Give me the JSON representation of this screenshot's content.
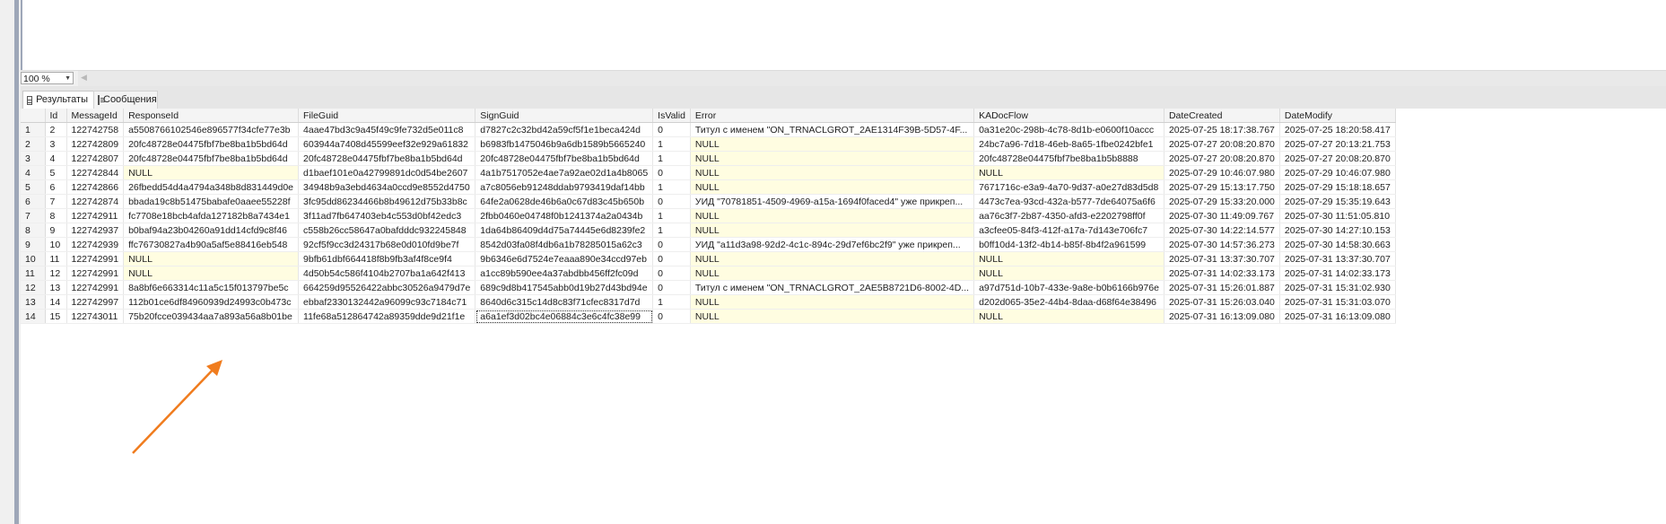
{
  "zoom": {
    "value": "100 %"
  },
  "tabs": [
    {
      "label": "Результаты",
      "icon": "grid-icon"
    },
    {
      "label": "Сообщения",
      "icon": "messages-icon"
    }
  ],
  "table": {
    "columns": [
      "",
      "Id",
      "MessageId",
      "ResponseId",
      "FileGuid",
      "SignGuid",
      "IsValid",
      "Error",
      "KADocFlow",
      "DateCreated",
      "DateModify"
    ],
    "rows": [
      [
        "1",
        "2",
        "122742758",
        "a5508766102546e896577f34cfe77e3b",
        "4aae47bd3c9a45f49c9fe732d5e011c8",
        "d7827c2c32bd42a59cf5f1e1beca424d",
        "0",
        "Титул с именем \"ON_TRNACLGROT_2AE1314F39B-5D57-4F...",
        "0a31e20c-298b-4c78-8d1b-e0600f10accc",
        "2025-07-25 18:17:38.767",
        "2025-07-25 18:20:58.417"
      ],
      [
        "2",
        "3",
        "122742809",
        "20fc48728e04475fbf7be8ba1b5bd64d",
        "603944a7408d45599eef32e929a61832",
        "b6983fb1475046b9a6db1589b5665240",
        "1",
        "NULL",
        "24bc7a96-7d18-46eb-8a65-1fbe0242bfe1",
        "2025-07-27 20:08:20.870",
        "2025-07-27 20:13:21.753"
      ],
      [
        "3",
        "4",
        "122742807",
        "20fc48728e04475fbf7be8ba1b5bd64d",
        "20fc48728e04475fbf7be8ba1b5bd64d",
        "20fc48728e04475fbf7be8ba1b5bd64d",
        "1",
        "NULL",
        "20fc48728e04475fbf7be8ba1b5b8888",
        "2025-07-27 20:08:20.870",
        "2025-07-27 20:08:20.870"
      ],
      [
        "4",
        "5",
        "122742844",
        "NULL",
        "d1baef101e0a42799891dc0d54be2607",
        "4a1b7517052e4ae7a92ae02d1a4b8065",
        "0",
        "NULL",
        "NULL",
        "2025-07-29 10:46:07.980",
        "2025-07-29 10:46:07.980"
      ],
      [
        "5",
        "6",
        "122742866",
        "26fbedd54d4a4794a348b8d831449d0e",
        "34948b9a3ebd4634a0ccd9e8552d4750",
        "a7c8056eb91248ddab9793419daf14bb",
        "1",
        "NULL",
        "7671716c-e3a9-4a70-9d37-a0e27d83d5d8",
        "2025-07-29 15:13:17.750",
        "2025-07-29 15:18:18.657"
      ],
      [
        "6",
        "7",
        "122742874",
        "bbada19c8b51475babafe0aaee55228f",
        "3fc95dd86234466b8b49612d75b33b8c",
        "64fe2a0628de46b6a0c67d83c45b650b",
        "0",
        "УИД \"70781851-4509-4969-a15a-1694f0faced4\" уже прикреп...",
        "4473c7ea-93cd-432a-b577-7de64075a6f6",
        "2025-07-29 15:33:20.000",
        "2025-07-29 15:35:19.643"
      ],
      [
        "7",
        "8",
        "122742911",
        "fc7708e18bcb4afda127182b8a7434e1",
        "3f11ad7fb647403eb4c553d0bf42edc3",
        "2fbb0460e04748f0b1241374a2a0434b",
        "1",
        "NULL",
        "aa76c3f7-2b87-4350-afd3-e2202798ff0f",
        "2025-07-30 11:49:09.767",
        "2025-07-30 11:51:05.810"
      ],
      [
        "8",
        "9",
        "122742937",
        "b0baf94a23b04260a91dd14cfd9c8f46",
        "c558b26cc58647a0bafdddc932245848",
        "1da64b86409d4d75a74445e6d8239fe2",
        "1",
        "NULL",
        "a3cfee05-84f3-412f-a17a-7d143e706fc7",
        "2025-07-30 14:22:14.577",
        "2025-07-30 14:27:10.153"
      ],
      [
        "9",
        "10",
        "122742939",
        "ffc76730827a4b90a5af5e88416eb548",
        "92cf5f9cc3d24317b68e0d010fd9be7f",
        "8542d03fa08f4db6a1b78285015a62c3",
        "0",
        "УИД \"a11d3a98-92d2-4c1c-894c-29d7ef6bc2f9\" уже прикреп...",
        "b0ff10d4-13f2-4b14-b85f-8b4f2a961599",
        "2025-07-30 14:57:36.273",
        "2025-07-30 14:58:30.663"
      ],
      [
        "10",
        "11",
        "122742991",
        "NULL",
        "9bfb61dbf664418f8b9fb3af4f8ce9f4",
        "9b6346e6d7524e7eaaa890e34ccd97eb",
        "0",
        "NULL",
        "NULL",
        "2025-07-31 13:37:30.707",
        "2025-07-31 13:37:30.707"
      ],
      [
        "11",
        "12",
        "122742991",
        "NULL",
        "4d50b54c586f4104b2707ba1a642f413",
        "a1cc89b590ee4a37abdbb456ff2fc09d",
        "0",
        "NULL",
        "NULL",
        "2025-07-31 14:02:33.173",
        "2025-07-31 14:02:33.173"
      ],
      [
        "12",
        "13",
        "122742991",
        "8a8bf6e663314c11a5c15f013797be5c",
        "664259d95526422abbc30526a9479d7e",
        "689c9d8b417545abb0d19b27d43bd94e",
        "0",
        "Титул с именем \"ON_TRNACLGROT_2AE5B8721D6-8002-4D...",
        "a97d751d-10b7-433e-9a8e-b0b6166b976e",
        "2025-07-31 15:26:01.887",
        "2025-07-31 15:31:02.930"
      ],
      [
        "13",
        "14",
        "122742997",
        "112b01ce6df84960939d24993c0b473c",
        "ebbaf2330132442a96099c93c7184c71",
        "8640d6c315c14d8c83f71cfec8317d7d",
        "1",
        "NULL",
        "d202d065-35e2-44b4-8daa-d68f64e38496",
        "2025-07-31 15:26:03.040",
        "2025-07-31 15:31:03.070"
      ],
      [
        "14",
        "15",
        "122743011",
        "75b20fcce039434aa7a893a56a8b01be",
        "11fe68a512864742a89359dde9d21f1e",
        "a6a1ef3d02bc4e06884c3e6c4fc38e99",
        "0",
        "NULL",
        "NULL",
        "2025-07-31 16:13:09.080",
        "2025-07-31 16:13:09.080"
      ]
    ]
  },
  "colors": {
    "null_bg": "#fffde1",
    "arrow": "#f07c1e"
  }
}
